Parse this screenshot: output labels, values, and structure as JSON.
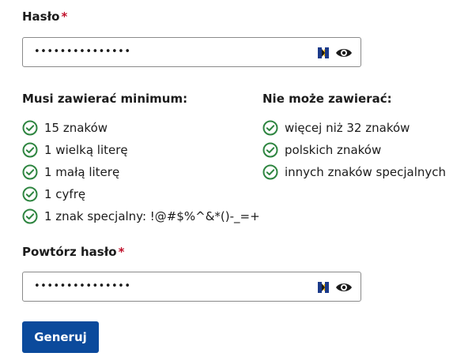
{
  "password": {
    "label": "Hasło",
    "required_mark": "*",
    "value": "•••••••••••••••"
  },
  "requirements": {
    "must_contain_title": "Musi zawierać minimum:",
    "must_contain": [
      "15 znaków",
      "1 wielką literę",
      "1 małą literę",
      "1 cyfrę",
      "1 znak specjalny: !@#$%^&*()-_=+"
    ],
    "cannot_contain_title": "Nie może zawierać:",
    "cannot_contain": [
      "więcej niż 32 znaków",
      "polskich znaków",
      "innych znaków specjalnych"
    ]
  },
  "repeat_password": {
    "label": "Powtórz hasło",
    "required_mark": "*",
    "value": "•••••••••••••••"
  },
  "generate_button": {
    "label": "Generuj"
  },
  "colors": {
    "check_green": "#2e8540",
    "button_blue": "#0b4a9c",
    "required_red": "#c0102a"
  },
  "icons": {
    "check": "check-circle-icon",
    "keeper": "keeper-icon",
    "eye": "eye-icon"
  }
}
